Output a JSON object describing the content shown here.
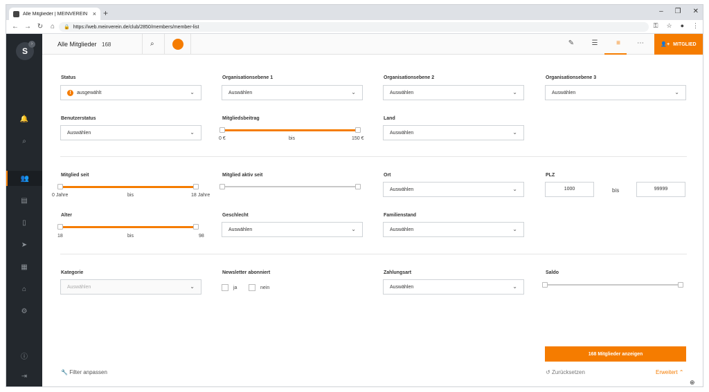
{
  "browser": {
    "tab_title": "Alle Mitglieder | MEINVEREIN",
    "tab_close": "×",
    "new_tab": "+",
    "url": "https://web.meinverein.de/club/2850/members/member-list",
    "controls": {
      "minimize": "–",
      "restore": "❐",
      "close": "✕"
    },
    "nav": {
      "back": "←",
      "forward": "→",
      "reload": "↻",
      "home": "⌂"
    },
    "right_icons": {
      "key": "⚿",
      "star": "☆",
      "profile": "●",
      "menu": "⋮"
    }
  },
  "header": {
    "title": "Alle Mitglieder",
    "count": "168",
    "add_member_label": "MITGLIED",
    "icons": [
      "search-icon",
      "club-logo-icon",
      "list-edit-icon",
      "list-filter-icon",
      "menu-icon",
      "more-icon",
      "add-member-icon"
    ]
  },
  "sidebar": {
    "logo": "S",
    "icons": [
      "bell-icon",
      "search-icon",
      "members-icon",
      "document-icon",
      "mobile-icon",
      "send-icon",
      "calendar-icon",
      "bank-icon",
      "gear-icon",
      "info-icon",
      "logout-icon"
    ]
  },
  "filters": {
    "status": {
      "label": "Status",
      "value": "ausgewählt"
    },
    "org1": {
      "label": "Organisationsebene 1",
      "value": "Auswählen"
    },
    "org2": {
      "label": "Organisationsebene 2",
      "value": "Auswählen"
    },
    "org3": {
      "label": "Organisationsebene 3",
      "value": "Auswählen"
    },
    "benutzerstatus": {
      "label": "Benutzerstatus",
      "value": "Auswählen"
    },
    "mitgliedsbeitrag": {
      "label": "Mitgliedsbeitrag",
      "min": "0 €",
      "mid": "bis",
      "max": "150 €",
      "fill_from": 0,
      "fill_to": 1
    },
    "land": {
      "label": "Land",
      "value": "Auswählen"
    },
    "mitglied_seit": {
      "label": "Mitglied seit",
      "min": "0 Jahre",
      "mid": "bis",
      "max": "18 Jahre",
      "fill_from": 0,
      "fill_to": 1
    },
    "mitglied_aktiv_seit": {
      "label": "Mitglied aktiv seit",
      "fill_from": 0,
      "fill_to": 0
    },
    "ort": {
      "label": "Ort",
      "value": "Auswählen"
    },
    "plz": {
      "label": "PLZ",
      "from": "1000",
      "mid": "bis",
      "to": "99999"
    },
    "alter": {
      "label": "Alter",
      "min": "18",
      "mid": "bis",
      "max": "98",
      "fill_from": 0,
      "fill_to": 1
    },
    "geschlecht": {
      "label": "Geschlecht",
      "value": "Auswählen"
    },
    "familienstand": {
      "label": "Familienstand",
      "value": "Auswählen"
    },
    "kategorie": {
      "label": "Kategorie",
      "value": "Auswählen"
    },
    "newsletter": {
      "label": "Newsletter abonniert",
      "yes": "ja",
      "no": "nein"
    },
    "zahlungsart": {
      "label": "Zahlungsart",
      "value": "Auswählen"
    },
    "saldo": {
      "label": "Saldo",
      "fill_from": 0,
      "fill_to": 0
    }
  },
  "footer": {
    "show_button": "168 Mitglieder anzeigen",
    "filter_anpassen": "Filter anpassen",
    "zuruecksetzen": "Zurücksetzen",
    "erweitert": "Erweitert ⌃"
  },
  "colors": {
    "accent": "#f57c00",
    "sidebar": "#23282d"
  }
}
